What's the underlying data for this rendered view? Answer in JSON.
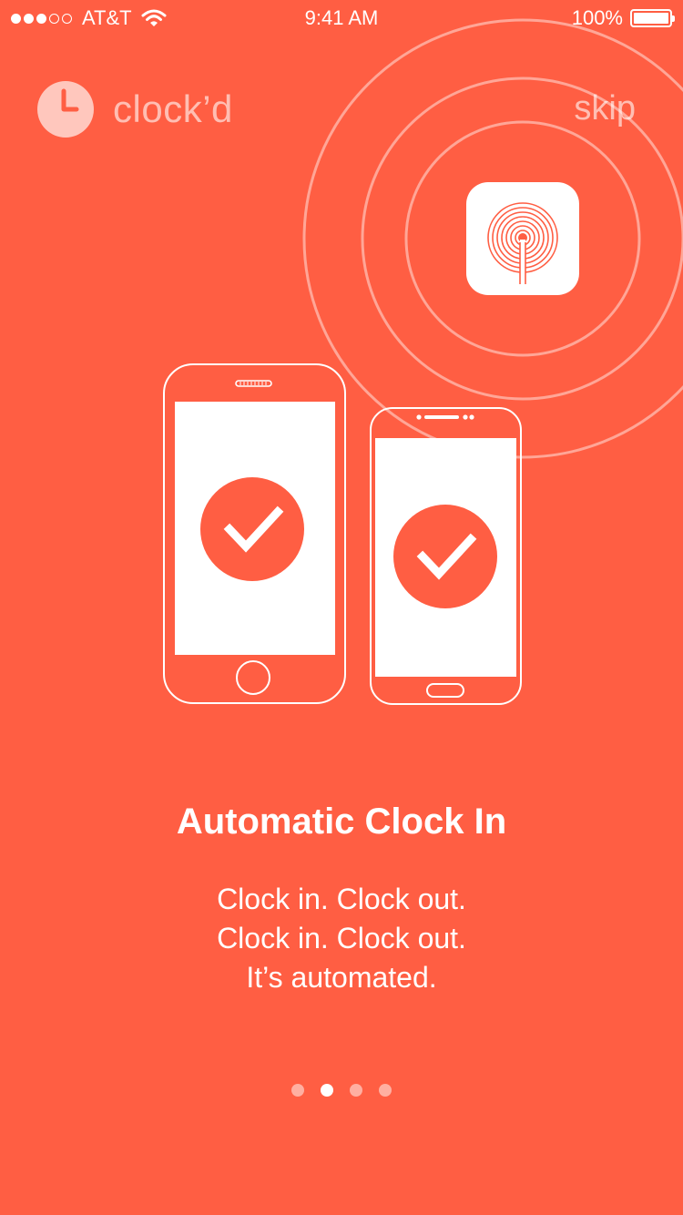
{
  "status_bar": {
    "carrier": "AT&T",
    "time": "9:41 AM",
    "battery": "100%",
    "signal_bars": 3,
    "signal_total": 5
  },
  "header": {
    "app_name": "clock’d",
    "skip_label": "skip"
  },
  "illustration": {
    "beacon_icon": "beacon-app-icon",
    "phones": [
      "iphone-check",
      "android-check"
    ]
  },
  "onboarding": {
    "title": "Automatic Clock In",
    "lines": [
      "Clock in. Clock out.",
      "Clock in. Clock out.",
      "It’s automated."
    ]
  },
  "pager": {
    "count": 4,
    "active_index": 1
  },
  "colors": {
    "background": "#FF5E43",
    "foreground": "#FFFFFF"
  }
}
